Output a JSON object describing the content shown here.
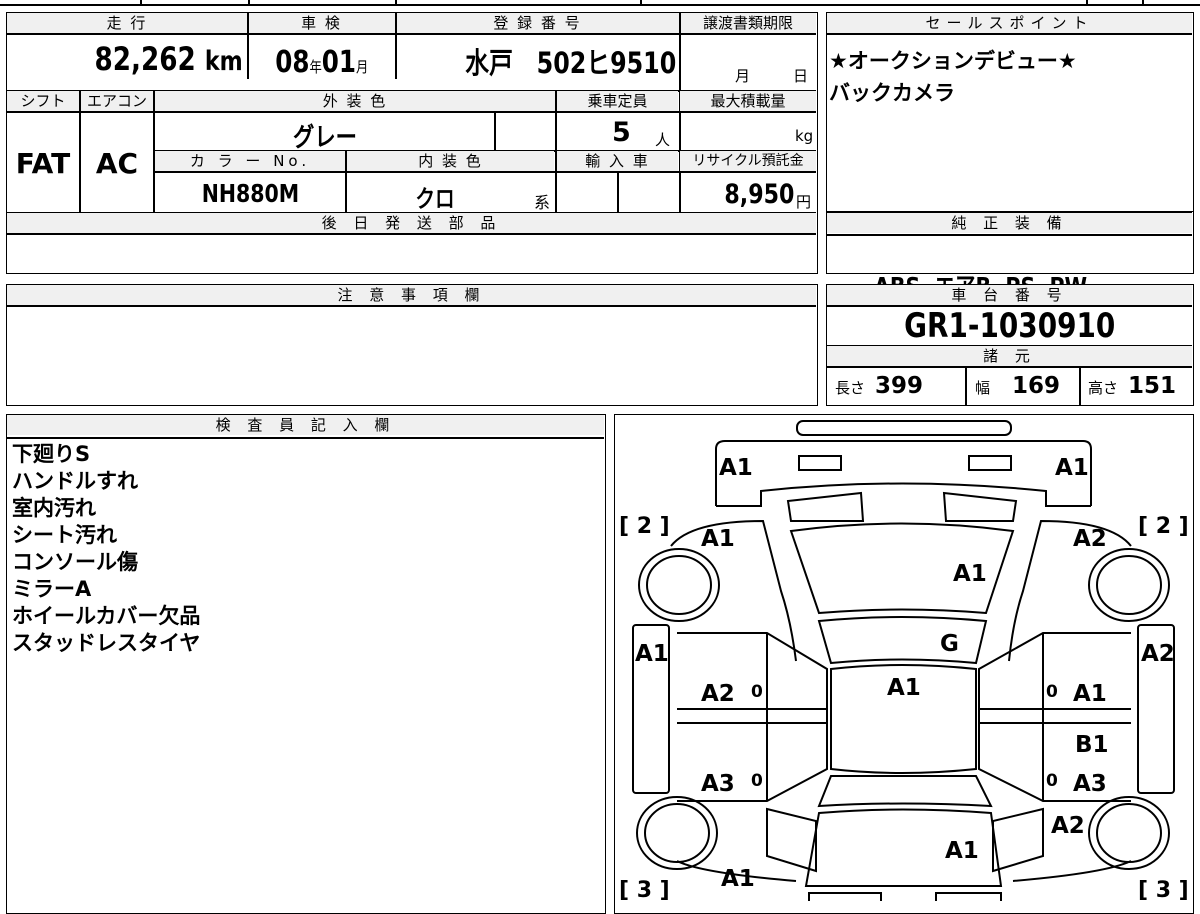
{
  "vehicle": {
    "mileage_header": "走 行",
    "mileage_value": "82,262",
    "mileage_unit": "km",
    "inspection_header": "車 検",
    "inspection_year": "08",
    "inspection_month": "01",
    "year_unit": "年",
    "month_unit": "月",
    "registration_header": "登 録 番 号",
    "registration_value": "水戸　502ヒ9510",
    "transfer_header": "譲渡書類期限",
    "transfer_month_label": "月",
    "transfer_day_label": "日",
    "shift_header": "シフト",
    "shift_value": "FAT",
    "aircon_header": "エアコン",
    "aircon_value": "AC",
    "exterior_header": "外 装 色",
    "exterior_value": "グレー",
    "capacity_header": "乗車定員",
    "capacity_value": "5",
    "capacity_unit": "人",
    "max_load_header": "最大積載量",
    "max_load_unit": "kg",
    "color_no_header": "カ ラ ー No.",
    "color_no_value": "NH880M",
    "interior_header": "内 装 色",
    "interior_value": "クロ",
    "interior_suffix": "系",
    "import_header": "輸 入 車",
    "recycle_header": "リサイクル預託金",
    "recycle_value": "8,950",
    "recycle_unit": "円",
    "later_parts_header": "後 日 発 送 部 品"
  },
  "sales_points": {
    "header": "セールスポイント",
    "lines": [
      "★オークションデビュー★",
      "バックカメラ"
    ]
  },
  "equipment": {
    "header": "純 正 装 備",
    "value": "ABS  エアB  PS  PW"
  },
  "notes": {
    "header": "注 意 事 項 欄"
  },
  "chassis": {
    "header": "車 台 番 号",
    "value": "GR1-1030910",
    "specs_header": "諸 元",
    "length_label": "長さ",
    "length_value": "399",
    "width_label": "幅",
    "width_value": "169",
    "height_label": "高さ",
    "height_value": "151"
  },
  "inspector": {
    "header": "検 査 員 記 入 欄",
    "lines": [
      "下廻りS",
      "ハンドルすれ",
      "室内汚れ",
      "シート汚れ",
      "コンソール傷",
      "ミラーA",
      "ホイールカバー欠品",
      "スタッドレスタイヤ"
    ]
  },
  "diagram": {
    "front_left_corner": "A1",
    "front_right_corner": "A1",
    "tire_front_left": "[ 2 ]",
    "tire_front_right": "[ 2 ]",
    "front_left_fender": "A1",
    "front_right_fender": "A2",
    "hood": "A1",
    "windshield": "G",
    "roof": "A1",
    "left_mirror": "A1",
    "right_mirror": "A2",
    "left_front_door": "A2",
    "left_rear_door": "A3",
    "right_front_door": "A1",
    "right_step": "B1",
    "right_rear_door": "A3",
    "right_rear_fender": "A2",
    "rear_area": "A1",
    "left_rear_quarter": "A1",
    "tire_rear_left": "[ 3 ]",
    "tire_rear_right": "[ 3 ]",
    "zero_lf": "0",
    "zero_lr": "0",
    "zero_rf": "0",
    "zero_rr": "0"
  }
}
